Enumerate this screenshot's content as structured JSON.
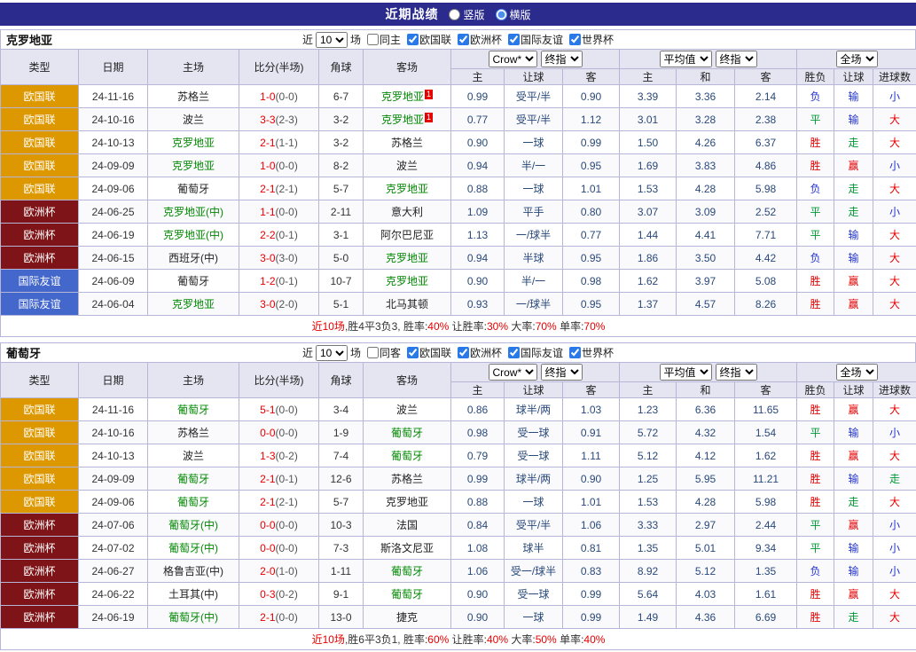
{
  "top_bar": {
    "title": "近期战绩",
    "options": [
      {
        "label": "竖版",
        "selected": false
      },
      {
        "label": "横版",
        "selected": true
      }
    ]
  },
  "colors": {
    "top_bar_bg": "#2b2b8d",
    "header_bg": "#e5e5f2",
    "team_green": "#008800",
    "score_red": "#e60000",
    "odds_text": "#29497a",
    "type_bg": {
      "欧国联": "#dd9800",
      "欧洲杯": "#7e1417",
      "国际友谊": "#4467cc"
    },
    "result": {
      "r": "#e60000",
      "g": "#009933",
      "b": "#2233cc"
    }
  },
  "filter_labels": {
    "near": "近",
    "games": "场"
  },
  "table_header": {
    "left_cols": [
      "类型",
      "日期",
      "主场",
      "比分(半场)",
      "角球",
      "客场"
    ],
    "odds_group": {
      "selects": [
        "Crow*",
        "终指"
      ],
      "cols": [
        "主",
        "让球",
        "客"
      ]
    },
    "avg_group": {
      "selects": [
        "平均值",
        "终指"
      ],
      "cols": [
        "主",
        "和",
        "客"
      ]
    },
    "result_group": {
      "selects": [
        "全场"
      ],
      "cols": [
        "胜负",
        "让球",
        "进球数"
      ]
    }
  },
  "sections": [
    {
      "team": "克罗地亚",
      "filter": {
        "count": "10",
        "same": {
          "label": "同主",
          "checked": false
        },
        "competitions": [
          {
            "label": "欧国联",
            "checked": true
          },
          {
            "label": "欧洲杯",
            "checked": true
          },
          {
            "label": "国际友谊",
            "checked": true
          },
          {
            "label": "世界杯",
            "checked": true
          }
        ]
      },
      "rows": [
        {
          "type": "欧国联",
          "date": "24-11-16",
          "home": {
            "name": "苏格兰",
            "focal": false,
            "badge": ""
          },
          "score": "1-0",
          "half": "(0-0)",
          "corners": "6-7",
          "away": {
            "name": "克罗地亚",
            "focal": true,
            "badge": "1"
          },
          "odds": [
            "0.99",
            "受平/半",
            "0.90"
          ],
          "avg": [
            "3.39",
            "3.36",
            "2.14"
          ],
          "results": [
            [
              "负",
              "b"
            ],
            [
              "输",
              "b"
            ],
            [
              "小",
              "b"
            ]
          ]
        },
        {
          "type": "欧国联",
          "date": "24-10-16",
          "home": {
            "name": "波兰",
            "focal": false,
            "badge": ""
          },
          "score": "3-3",
          "half": "(2-3)",
          "corners": "3-2",
          "away": {
            "name": "克罗地亚",
            "focal": true,
            "badge": "1"
          },
          "odds": [
            "0.77",
            "受平/半",
            "1.12"
          ],
          "avg": [
            "3.01",
            "3.28",
            "2.38"
          ],
          "results": [
            [
              "平",
              "g"
            ],
            [
              "输",
              "b"
            ],
            [
              "大",
              "r"
            ]
          ]
        },
        {
          "type": "欧国联",
          "date": "24-10-13",
          "home": {
            "name": "克罗地亚",
            "focal": true,
            "badge": ""
          },
          "score": "2-1",
          "half": "(1-1)",
          "corners": "3-2",
          "away": {
            "name": "苏格兰",
            "focal": false,
            "badge": ""
          },
          "odds": [
            "0.90",
            "一球",
            "0.99"
          ],
          "avg": [
            "1.50",
            "4.26",
            "6.37"
          ],
          "results": [
            [
              "胜",
              "r"
            ],
            [
              "走",
              "g"
            ],
            [
              "大",
              "r"
            ]
          ]
        },
        {
          "type": "欧国联",
          "date": "24-09-09",
          "home": {
            "name": "克罗地亚",
            "focal": true,
            "badge": ""
          },
          "score": "1-0",
          "half": "(0-0)",
          "corners": "8-2",
          "away": {
            "name": "波兰",
            "focal": false,
            "badge": ""
          },
          "odds": [
            "0.94",
            "半/一",
            "0.95"
          ],
          "avg": [
            "1.69",
            "3.83",
            "4.86"
          ],
          "results": [
            [
              "胜",
              "r"
            ],
            [
              "赢",
              "r"
            ],
            [
              "小",
              "b"
            ]
          ]
        },
        {
          "type": "欧国联",
          "date": "24-09-06",
          "home": {
            "name": "葡萄牙",
            "focal": false,
            "badge": ""
          },
          "score": "2-1",
          "half": "(2-1)",
          "corners": "5-7",
          "away": {
            "name": "克罗地亚",
            "focal": true,
            "badge": ""
          },
          "odds": [
            "0.88",
            "一球",
            "1.01"
          ],
          "avg": [
            "1.53",
            "4.28",
            "5.98"
          ],
          "results": [
            [
              "负",
              "b"
            ],
            [
              "走",
              "g"
            ],
            [
              "大",
              "r"
            ]
          ]
        },
        {
          "type": "欧洲杯",
          "date": "24-06-25",
          "home": {
            "name": "克罗地亚(中)",
            "focal": true,
            "badge": ""
          },
          "score": "1-1",
          "half": "(0-0)",
          "corners": "2-11",
          "away": {
            "name": "意大利",
            "focal": false,
            "badge": ""
          },
          "odds": [
            "1.09",
            "平手",
            "0.80"
          ],
          "avg": [
            "3.07",
            "3.09",
            "2.52"
          ],
          "results": [
            [
              "平",
              "g"
            ],
            [
              "走",
              "g"
            ],
            [
              "小",
              "b"
            ]
          ]
        },
        {
          "type": "欧洲杯",
          "date": "24-06-19",
          "home": {
            "name": "克罗地亚(中)",
            "focal": true,
            "badge": ""
          },
          "score": "2-2",
          "half": "(0-1)",
          "corners": "3-1",
          "away": {
            "name": "阿尔巴尼亚",
            "focal": false,
            "badge": ""
          },
          "odds": [
            "1.13",
            "一/球半",
            "0.77"
          ],
          "avg": [
            "1.44",
            "4.41",
            "7.71"
          ],
          "results": [
            [
              "平",
              "g"
            ],
            [
              "输",
              "b"
            ],
            [
              "大",
              "r"
            ]
          ]
        },
        {
          "type": "欧洲杯",
          "date": "24-06-15",
          "home": {
            "name": "西班牙(中)",
            "focal": false,
            "badge": ""
          },
          "score": "3-0",
          "half": "(3-0)",
          "corners": "5-0",
          "away": {
            "name": "克罗地亚",
            "focal": true,
            "badge": ""
          },
          "odds": [
            "0.94",
            "半球",
            "0.95"
          ],
          "avg": [
            "1.86",
            "3.50",
            "4.42"
          ],
          "results": [
            [
              "负",
              "b"
            ],
            [
              "输",
              "b"
            ],
            [
              "大",
              "r"
            ]
          ]
        },
        {
          "type": "国际友谊",
          "date": "24-06-09",
          "home": {
            "name": "葡萄牙",
            "focal": false,
            "badge": ""
          },
          "score": "1-2",
          "half": "(0-1)",
          "corners": "10-7",
          "away": {
            "name": "克罗地亚",
            "focal": true,
            "badge": ""
          },
          "odds": [
            "0.90",
            "半/一",
            "0.98"
          ],
          "avg": [
            "1.62",
            "3.97",
            "5.08"
          ],
          "results": [
            [
              "胜",
              "r"
            ],
            [
              "赢",
              "r"
            ],
            [
              "大",
              "r"
            ]
          ]
        },
        {
          "type": "国际友谊",
          "date": "24-06-04",
          "home": {
            "name": "克罗地亚",
            "focal": true,
            "badge": ""
          },
          "score": "3-0",
          "half": "(2-0)",
          "corners": "5-1",
          "away": {
            "name": "北马其顿",
            "focal": false,
            "badge": ""
          },
          "odds": [
            "0.93",
            "一/球半",
            "0.95"
          ],
          "avg": [
            "1.37",
            "4.57",
            "8.26"
          ],
          "results": [
            [
              "胜",
              "r"
            ],
            [
              "赢",
              "r"
            ],
            [
              "大",
              "r"
            ]
          ]
        }
      ],
      "summary": [
        {
          "t": "近10场",
          "c": "red"
        },
        {
          "t": ",胜4平3负3, 胜率:",
          "c": "dark"
        },
        {
          "t": "40%",
          "c": "red"
        },
        {
          "t": " 让胜率:",
          "c": "dark"
        },
        {
          "t": "30%",
          "c": "red"
        },
        {
          "t": " 大率:",
          "c": "dark"
        },
        {
          "t": "70%",
          "c": "red"
        },
        {
          "t": " 单率:",
          "c": "dark"
        },
        {
          "t": "70%",
          "c": "red"
        }
      ]
    },
    {
      "team": "葡萄牙",
      "filter": {
        "count": "10",
        "same": {
          "label": "同客",
          "checked": false
        },
        "competitions": [
          {
            "label": "欧国联",
            "checked": true
          },
          {
            "label": "欧洲杯",
            "checked": true
          },
          {
            "label": "国际友谊",
            "checked": true
          },
          {
            "label": "世界杯",
            "checked": true
          }
        ]
      },
      "rows": [
        {
          "type": "欧国联",
          "date": "24-11-16",
          "home": {
            "name": "葡萄牙",
            "focal": true,
            "badge": ""
          },
          "score": "5-1",
          "half": "(0-0)",
          "corners": "3-4",
          "away": {
            "name": "波兰",
            "focal": false,
            "badge": ""
          },
          "odds": [
            "0.86",
            "球半/两",
            "1.03"
          ],
          "avg": [
            "1.23",
            "6.36",
            "11.65"
          ],
          "results": [
            [
              "胜",
              "r"
            ],
            [
              "赢",
              "r"
            ],
            [
              "大",
              "r"
            ]
          ]
        },
        {
          "type": "欧国联",
          "date": "24-10-16",
          "home": {
            "name": "苏格兰",
            "focal": false,
            "badge": ""
          },
          "score": "0-0",
          "half": "(0-0)",
          "corners": "1-9",
          "away": {
            "name": "葡萄牙",
            "focal": true,
            "badge": ""
          },
          "odds": [
            "0.98",
            "受一球",
            "0.91"
          ],
          "avg": [
            "5.72",
            "4.32",
            "1.54"
          ],
          "results": [
            [
              "平",
              "g"
            ],
            [
              "输",
              "b"
            ],
            [
              "小",
              "b"
            ]
          ]
        },
        {
          "type": "欧国联",
          "date": "24-10-13",
          "home": {
            "name": "波兰",
            "focal": false,
            "badge": ""
          },
          "score": "1-3",
          "half": "(0-2)",
          "corners": "7-4",
          "away": {
            "name": "葡萄牙",
            "focal": true,
            "badge": ""
          },
          "odds": [
            "0.79",
            "受一球",
            "1.11"
          ],
          "avg": [
            "5.12",
            "4.12",
            "1.62"
          ],
          "results": [
            [
              "胜",
              "r"
            ],
            [
              "赢",
              "r"
            ],
            [
              "大",
              "r"
            ]
          ]
        },
        {
          "type": "欧国联",
          "date": "24-09-09",
          "home": {
            "name": "葡萄牙",
            "focal": true,
            "badge": ""
          },
          "score": "2-1",
          "half": "(0-1)",
          "corners": "12-6",
          "away": {
            "name": "苏格兰",
            "focal": false,
            "badge": ""
          },
          "odds": [
            "0.99",
            "球半/两",
            "0.90"
          ],
          "avg": [
            "1.25",
            "5.95",
            "11.21"
          ],
          "results": [
            [
              "胜",
              "r"
            ],
            [
              "输",
              "b"
            ],
            [
              "走",
              "g"
            ]
          ]
        },
        {
          "type": "欧国联",
          "date": "24-09-06",
          "home": {
            "name": "葡萄牙",
            "focal": true,
            "badge": ""
          },
          "score": "2-1",
          "half": "(2-1)",
          "corners": "5-7",
          "away": {
            "name": "克罗地亚",
            "focal": false,
            "badge": ""
          },
          "odds": [
            "0.88",
            "一球",
            "1.01"
          ],
          "avg": [
            "1.53",
            "4.28",
            "5.98"
          ],
          "results": [
            [
              "胜",
              "r"
            ],
            [
              "走",
              "g"
            ],
            [
              "大",
              "r"
            ]
          ]
        },
        {
          "type": "欧洲杯",
          "date": "24-07-06",
          "home": {
            "name": "葡萄牙(中)",
            "focal": true,
            "badge": ""
          },
          "score": "0-0",
          "half": "(0-0)",
          "corners": "10-3",
          "away": {
            "name": "法国",
            "focal": false,
            "badge": ""
          },
          "odds": [
            "0.84",
            "受平/半",
            "1.06"
          ],
          "avg": [
            "3.33",
            "2.97",
            "2.44"
          ],
          "results": [
            [
              "平",
              "g"
            ],
            [
              "赢",
              "r"
            ],
            [
              "小",
              "b"
            ]
          ]
        },
        {
          "type": "欧洲杯",
          "date": "24-07-02",
          "home": {
            "name": "葡萄牙(中)",
            "focal": true,
            "badge": ""
          },
          "score": "0-0",
          "half": "(0-0)",
          "corners": "7-3",
          "away": {
            "name": "斯洛文尼亚",
            "focal": false,
            "badge": ""
          },
          "odds": [
            "1.08",
            "球半",
            "0.81"
          ],
          "avg": [
            "1.35",
            "5.01",
            "9.34"
          ],
          "results": [
            [
              "平",
              "g"
            ],
            [
              "输",
              "b"
            ],
            [
              "小",
              "b"
            ]
          ]
        },
        {
          "type": "欧洲杯",
          "date": "24-06-27",
          "home": {
            "name": "格鲁吉亚(中)",
            "focal": false,
            "badge": ""
          },
          "score": "2-0",
          "half": "(1-0)",
          "corners": "1-11",
          "away": {
            "name": "葡萄牙",
            "focal": true,
            "badge": ""
          },
          "odds": [
            "1.06",
            "受一/球半",
            "0.83"
          ],
          "avg": [
            "8.92",
            "5.12",
            "1.35"
          ],
          "results": [
            [
              "负",
              "b"
            ],
            [
              "输",
              "b"
            ],
            [
              "小",
              "b"
            ]
          ]
        },
        {
          "type": "欧洲杯",
          "date": "24-06-22",
          "home": {
            "name": "土耳其(中)",
            "focal": false,
            "badge": ""
          },
          "score": "0-3",
          "half": "(0-2)",
          "corners": "9-1",
          "away": {
            "name": "葡萄牙",
            "focal": true,
            "badge": ""
          },
          "odds": [
            "0.90",
            "受一球",
            "0.99"
          ],
          "avg": [
            "5.64",
            "4.03",
            "1.61"
          ],
          "results": [
            [
              "胜",
              "r"
            ],
            [
              "赢",
              "r"
            ],
            [
              "大",
              "r"
            ]
          ]
        },
        {
          "type": "欧洲杯",
          "date": "24-06-19",
          "home": {
            "name": "葡萄牙(中)",
            "focal": true,
            "badge": ""
          },
          "score": "2-1",
          "half": "(0-0)",
          "corners": "13-0",
          "away": {
            "name": "捷克",
            "focal": false,
            "badge": ""
          },
          "odds": [
            "0.90",
            "一球",
            "0.99"
          ],
          "avg": [
            "1.49",
            "4.36",
            "6.69"
          ],
          "results": [
            [
              "胜",
              "r"
            ],
            [
              "走",
              "g"
            ],
            [
              "大",
              "r"
            ]
          ]
        }
      ],
      "summary": [
        {
          "t": "近10场",
          "c": "red"
        },
        {
          "t": ",胜6平3负1, 胜率:",
          "c": "dark"
        },
        {
          "t": "60%",
          "c": "red"
        },
        {
          "t": " 让胜率:",
          "c": "dark"
        },
        {
          "t": "40%",
          "c": "red"
        },
        {
          "t": " 大率:",
          "c": "dark"
        },
        {
          "t": "50%",
          "c": "red"
        },
        {
          "t": " 单率:",
          "c": "dark"
        },
        {
          "t": "40%",
          "c": "red"
        }
      ]
    }
  ]
}
